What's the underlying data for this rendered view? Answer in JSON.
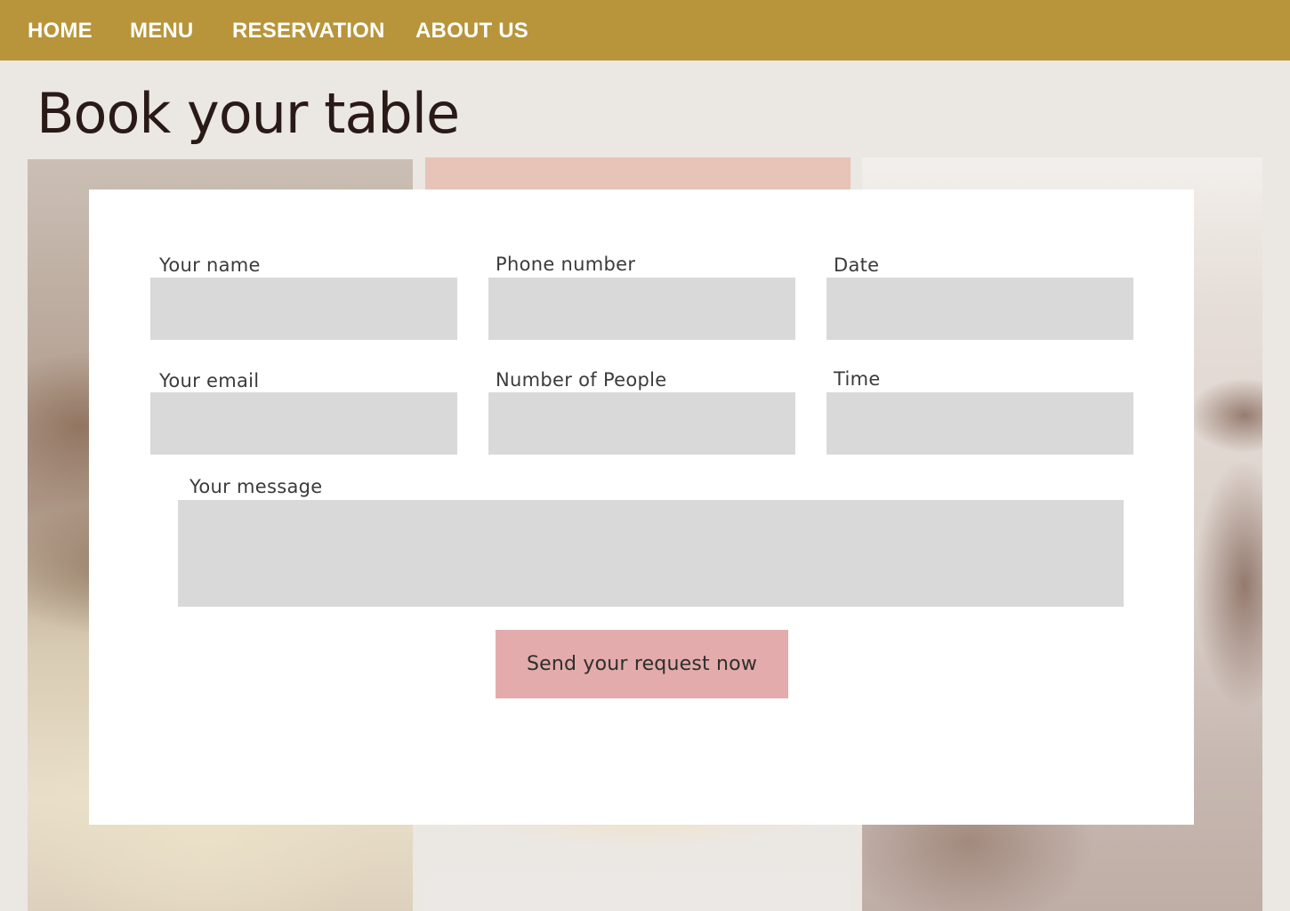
{
  "nav": {
    "items": [
      {
        "label": "HOME"
      },
      {
        "label": "MENU"
      },
      {
        "label": "RESERVATION"
      },
      {
        "label": "ABOUT US"
      }
    ]
  },
  "page": {
    "title": "Book your table"
  },
  "form": {
    "name_label": "Your name",
    "phone_label": "Phone number",
    "date_label": "Date",
    "email_label": "Your email",
    "people_label": "Number of People",
    "time_label": "Time",
    "message_label": "Your message",
    "submit_label": "Send your request now",
    "name_value": "",
    "phone_value": "",
    "date_value": "",
    "email_value": "",
    "people_value": "",
    "time_value": "",
    "message_value": ""
  },
  "colors": {
    "navbar": "#b8953a",
    "page_background": "#ebe7e3",
    "input_fill": "#d9d9d9",
    "button": "#e3abab",
    "title_text": "#2a1a17"
  }
}
